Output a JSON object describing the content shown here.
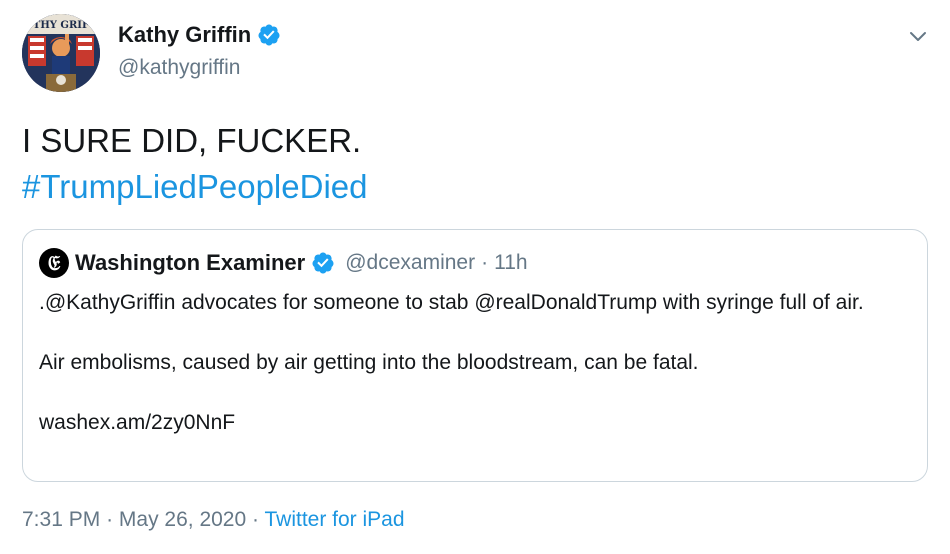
{
  "author": {
    "name": "Kathy Griffin",
    "handle": "@kathygriffin",
    "avatar_text": "THY GRIF"
  },
  "tweet": {
    "line1": "I SURE DID, FUCKER.",
    "hashtag": "#TrumpLiedPeopleDied"
  },
  "quote": {
    "name": "Washington Examiner",
    "handle": "@dcexaminer",
    "separator": "·",
    "time": "11h",
    "para1": ".@KathyGriffin advocates for someone to stab @realDonaldTrump with syringe full of air.",
    "para2": "Air embolisms, caused by air getting into the bloodstream, can be fatal.",
    "link": "washex.am/2zy0NnF"
  },
  "footer": {
    "time": "7:31 PM",
    "date": "May 26, 2020",
    "separator": "·",
    "source": "Twitter for iPad"
  },
  "colors": {
    "link": "#1b95e0",
    "secondary_text": "#657786",
    "verified": "#1da1f2",
    "border": "#ccd6dd"
  },
  "icons": {
    "verified": "verified-badge-icon",
    "caret": "chevron-down-icon",
    "quote_logo": "washington-examiner-logo"
  }
}
